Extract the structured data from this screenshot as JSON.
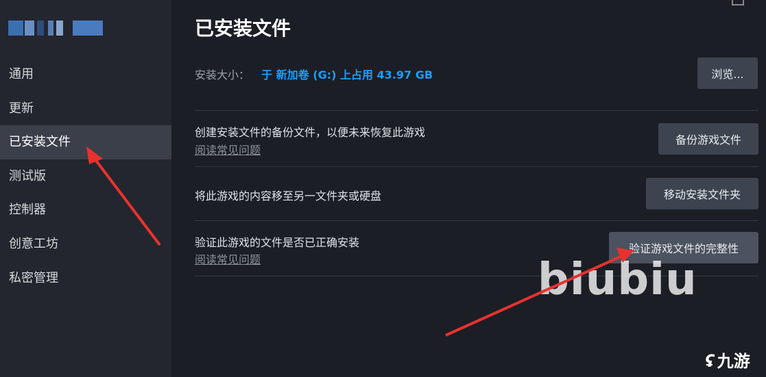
{
  "sidebar": {
    "items": [
      {
        "label": "通用"
      },
      {
        "label": "更新"
      },
      {
        "label": "已安装文件"
      },
      {
        "label": "测试版"
      },
      {
        "label": "控制器"
      },
      {
        "label": "创意工坊"
      },
      {
        "label": "私密管理"
      }
    ],
    "active_index": 2
  },
  "main": {
    "title": "已安装文件",
    "install_size": {
      "label": "安装大小：",
      "value": "于 新加卷 (G:) 上占用 43.97 GB",
      "browse_button": "浏览..."
    },
    "rows": [
      {
        "text": "创建安装文件的备份文件，以便未来恢复此游戏",
        "faq": "阅读常见问题",
        "button": "备份游戏文件"
      },
      {
        "text": "将此游戏的内容移至另一文件夹或硬盘",
        "button": "移动安装文件夹"
      },
      {
        "text": "验证此游戏的文件是否已正确安装",
        "faq": "阅读常见问题",
        "button": "验证游戏文件的完整性"
      }
    ]
  },
  "overlay": {
    "watermark": "biubiu",
    "logo_text": "九游",
    "arrow_color": "#e8322f"
  }
}
